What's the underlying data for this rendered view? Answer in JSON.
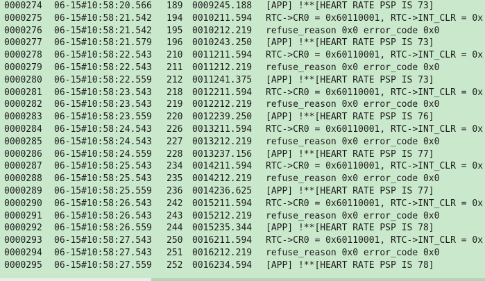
{
  "log": {
    "rows": [
      {
        "index": "0000274",
        "time": "06-15#10:58:20.566",
        "tick": "189",
        "ms": "0009245.188",
        "message": "[APP] !**[HEART RATE PSP IS 73]"
      },
      {
        "index": "0000275",
        "time": "06-15#10:58:21.542",
        "tick": "194",
        "ms": "0010211.594",
        "message": "RTC->CR0 = 0x60110001, RTC->INT_CLR = 0x"
      },
      {
        "index": "0000276",
        "time": "06-15#10:58:21.542",
        "tick": "195",
        "ms": "0010212.219",
        "message": "refuse_reason 0x0 error_code 0x0"
      },
      {
        "index": "0000277",
        "time": "06-15#10:58:21.579",
        "tick": "196",
        "ms": "0010243.250",
        "message": "[APP] !**[HEART RATE PSP IS 73]"
      },
      {
        "index": "0000278",
        "time": "06-15#10:58:22.543",
        "tick": "210",
        "ms": "0011211.594",
        "message": "RTC->CR0 = 0x60110001, RTC->INT_CLR = 0x"
      },
      {
        "index": "0000279",
        "time": "06-15#10:58:22.543",
        "tick": "211",
        "ms": "0011212.219",
        "message": "refuse_reason 0x0 error_code 0x0"
      },
      {
        "index": "0000280",
        "time": "06-15#10:58:22.559",
        "tick": "212",
        "ms": "0011241.375",
        "message": "[APP] !**[HEART RATE PSP IS 73]"
      },
      {
        "index": "0000281",
        "time": "06-15#10:58:23.543",
        "tick": "218",
        "ms": "0012211.594",
        "message": "RTC->CR0 = 0x60110001, RTC->INT_CLR = 0x"
      },
      {
        "index": "0000282",
        "time": "06-15#10:58:23.543",
        "tick": "219",
        "ms": "0012212.219",
        "message": "refuse_reason 0x0 error_code 0x0"
      },
      {
        "index": "0000283",
        "time": "06-15#10:58:23.559",
        "tick": "220",
        "ms": "0012239.250",
        "message": "[APP] !**[HEART RATE PSP IS 76]"
      },
      {
        "index": "0000284",
        "time": "06-15#10:58:24.543",
        "tick": "226",
        "ms": "0013211.594",
        "message": "RTC->CR0 = 0x60110001, RTC->INT_CLR = 0x"
      },
      {
        "index": "0000285",
        "time": "06-15#10:58:24.543",
        "tick": "227",
        "ms": "0013212.219",
        "message": "refuse_reason 0x0 error_code 0x0"
      },
      {
        "index": "0000286",
        "time": "06-15#10:58:24.559",
        "tick": "228",
        "ms": "0013237.156",
        "message": "[APP] !**[HEART RATE PSP IS 77]"
      },
      {
        "index": "0000287",
        "time": "06-15#10:58:25.543",
        "tick": "234",
        "ms": "0014211.594",
        "message": "RTC->CR0 = 0x60110001, RTC->INT_CLR = 0x"
      },
      {
        "index": "0000288",
        "time": "06-15#10:58:25.543",
        "tick": "235",
        "ms": "0014212.219",
        "message": "refuse_reason 0x0 error_code 0x0"
      },
      {
        "index": "0000289",
        "time": "06-15#10:58:25.559",
        "tick": "236",
        "ms": "0014236.625",
        "message": "[APP] !**[HEART RATE PSP IS 77]"
      },
      {
        "index": "0000290",
        "time": "06-15#10:58:26.543",
        "tick": "242",
        "ms": "0015211.594",
        "message": "RTC->CR0 = 0x60110001, RTC->INT_CLR = 0x"
      },
      {
        "index": "0000291",
        "time": "06-15#10:58:26.543",
        "tick": "243",
        "ms": "0015212.219",
        "message": "refuse_reason 0x0 error_code 0x0"
      },
      {
        "index": "0000292",
        "time": "06-15#10:58:26.559",
        "tick": "244",
        "ms": "0015235.344",
        "message": "[APP] !**[HEART RATE PSP IS 78]"
      },
      {
        "index": "0000293",
        "time": "06-15#10:58:27.543",
        "tick": "250",
        "ms": "0016211.594",
        "message": "RTC->CR0 = 0x60110001, RTC->INT_CLR = 0x"
      },
      {
        "index": "0000294",
        "time": "06-15#10:58:27.543",
        "tick": "251",
        "ms": "0016212.219",
        "message": "refuse_reason 0x0 error_code 0x0"
      },
      {
        "index": "0000295",
        "time": "06-15#10:58:27.559",
        "tick": "252",
        "ms": "0016234.594",
        "message": "[APP] !**[HEART RATE PSP IS 78]"
      }
    ]
  },
  "theme": {
    "background": "#cae8cc",
    "text": "#1c1c1c",
    "scroll_track": "#b6d2b8",
    "scroll_thumb": "#e9ece9"
  }
}
